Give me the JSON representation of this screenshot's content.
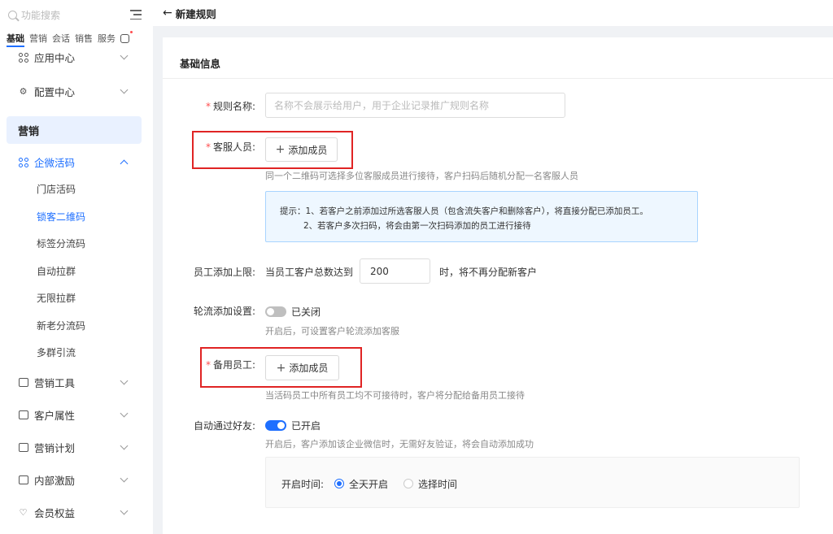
{
  "sidebar": {
    "search_placeholder": "功能搜索",
    "categories": [
      "基础",
      "营销",
      "会话",
      "销售",
      "服务"
    ],
    "top_items": [
      {
        "label": "应用中心",
        "icon": "grid-icon"
      },
      {
        "label": "配置中心",
        "icon": "settings-icon"
      }
    ],
    "section_title": "营销",
    "group": {
      "label": "企微活码",
      "icon": "grid-icon",
      "sub_items": [
        "门店活码",
        "锁客二维码",
        "标签分流码",
        "自动拉群",
        "无限拉群",
        "新老分流码",
        "多群引流"
      ],
      "active_sub": "锁客二维码"
    },
    "bottom_items": [
      {
        "label": "营销工具",
        "icon": "tool-icon"
      },
      {
        "label": "客户属性",
        "icon": "id-card-icon"
      },
      {
        "label": "营销计划",
        "icon": "chart-icon"
      },
      {
        "label": "内部激励",
        "icon": "gift-icon"
      },
      {
        "label": "会员权益",
        "icon": "heart-icon"
      }
    ]
  },
  "header": {
    "back_arrow": "←",
    "title": "新建规则"
  },
  "form": {
    "section_title": "基础信息",
    "rule_name": {
      "label": "规则名称:",
      "placeholder": "名称不会展示给用户，用于企业记录推广规则名称"
    },
    "service_staff": {
      "label": "客服人员:",
      "button": "添加成员",
      "hint": "同一个二维码可选择多位客服成员进行接待，客户扫码后随机分配一名客服人员"
    },
    "tip": {
      "line1": "提示：1、若客户之前添加过所选客服人员（包含流失客户和删除客户），将直接分配已添加员工。",
      "line2": "2、若客户多次扫码，将会由第一次扫码添加的员工进行接待"
    },
    "limit": {
      "label": "员工添加上限:",
      "prefix": "当员工客户总数达到",
      "value": "200",
      "suffix": "时，将不再分配新客户"
    },
    "rotation": {
      "label": "轮流添加设置:",
      "status": "已关闭",
      "hint": "开启后，可设置客户轮流添加客服",
      "enabled": false
    },
    "backup_staff": {
      "label": "备用员工:",
      "button": "添加成员",
      "hint": "当活码员工中所有员工均不可接待时，客户将分配给备用员工接待"
    },
    "auto_accept": {
      "label": "自动通过好友:",
      "status": "已开启",
      "hint": "开启后，客户添加该企业微信时，无需好友验证，将会自动添加成功",
      "enabled": true
    },
    "open_time": {
      "label": "开启时间:",
      "options": [
        "全天开启",
        "选择时间"
      ],
      "selected": "全天开启"
    }
  },
  "colors": {
    "accent": "#1e6fff",
    "required": "#ff4d4f",
    "highlight_box": "#e02424"
  }
}
